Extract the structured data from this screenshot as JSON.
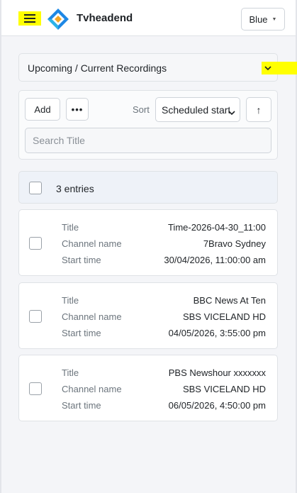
{
  "header": {
    "app_title": "Tvheadend",
    "theme_label": "Blue",
    "theme_caret": "▼"
  },
  "section_select": {
    "label": "Upcoming / Current Recordings"
  },
  "toolbar": {
    "add_label": "Add",
    "more_label": "•••",
    "sort_label": "Sort",
    "sort_value": "Scheduled start",
    "sort_direction": "↑",
    "search_placeholder": "Search Title"
  },
  "summary": {
    "count_text": "3 entries"
  },
  "recordings": [
    {
      "title_key": "Title",
      "title": "Time-2026-04-30_11:00",
      "channel_key": "Channel name",
      "channel": "7Bravo Sydney",
      "start_key": "Start time",
      "start": "30/04/2026, 11:00:00 am"
    },
    {
      "title_key": "Title",
      "title": "BBC News At Ten",
      "channel_key": "Channel name",
      "channel": "SBS VICELAND HD",
      "start_key": "Start time",
      "start": "04/05/2026, 3:55:00 pm"
    },
    {
      "title_key": "Title",
      "title": "PBS Newshour xxxxxxx",
      "channel_key": "Channel name",
      "channel": "SBS VICELAND HD",
      "start_key": "Start time",
      "start": "06/05/2026, 4:50:00 pm"
    }
  ],
  "colors": {
    "highlight": "#ffff00",
    "logo_blue": "#1e88e5",
    "logo_orange": "#f5a623"
  }
}
